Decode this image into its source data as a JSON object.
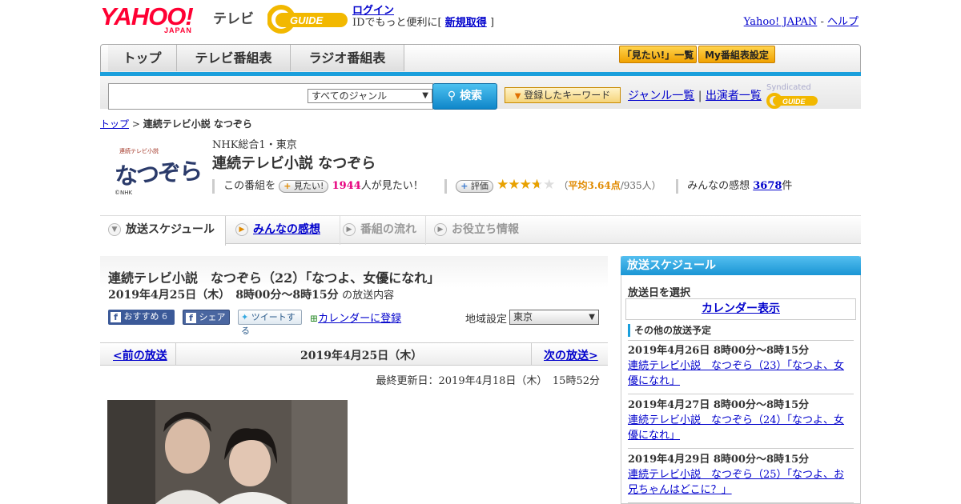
{
  "header": {
    "yahoo_logo": "YAHOO!",
    "yahoo_sub": "JAPAN",
    "tv_label": "テレビ",
    "gguide_logo": "G-GUIDE",
    "login_link": "ログイン",
    "login_text": "IDでもっと便利に[",
    "register_link": "新規取得",
    "login_close": "]",
    "yahoo_japan_link": "Yahoo! JAPAN",
    "separator": "-",
    "help_link": "ヘルプ"
  },
  "nav": {
    "tabs": [
      "トップ",
      "テレビ番組表",
      "ラジオ番組表"
    ],
    "want_list": "「見たい!」一覧",
    "my_schedule": "My番組表設定"
  },
  "search": {
    "input_value": "",
    "genre": "すべてのジャンル",
    "button": "検索",
    "keyword_button": "登録したキーワード",
    "genre_list": "ジャンル一覧",
    "divider": "|",
    "performer_list": "出演者一覧",
    "syndicated": "Syndicated"
  },
  "breadcrumb": {
    "top": "トップ",
    "sep": ">",
    "current": "連続テレビ小説 なつぞら"
  },
  "program": {
    "logo_text": "なつぞら",
    "logo_small": "連続テレビ小説",
    "logo_nhk": "©NHK",
    "channel": "NHK総合1・東京",
    "title": "連続テレビ小説 なつぞら",
    "want_prefix": "この番組を",
    "want_button": "見たい!",
    "want_count": "1944",
    "want_suffix": "人が見たい！",
    "rate_button": "評価",
    "rating": 3.64,
    "rating_open": "（",
    "rating_avg": "平均3.64点",
    "rating_count": "/935人）",
    "impressions_label": "みんなの感想",
    "impressions_count": "3678",
    "impressions_unit": "件"
  },
  "program_tabs": [
    "放送スケジュール",
    "みんなの感想",
    "番組の流れ",
    "お役立ち情報"
  ],
  "episode": {
    "title": "連続テレビ小説　なつぞら（22）「なつよ、女優になれ」",
    "datetime": "2019年4月25日（木）　8時00分～8時15分",
    "datetime_suffix": "の放送内容",
    "recommend_label": "おすすめ",
    "recommend_count": "6",
    "share_label": "シェア",
    "tweet_label": "ツイートする",
    "calendar_label": "カレンダーに登録",
    "region_label": "地域設定",
    "region_value": "東京",
    "prev": "<前の放送",
    "current_date": "2019年4月25日（木）",
    "next": "次の放送>",
    "updated": "最終更新日：2019年4月18日（木）　15時52分"
  },
  "sidebar": {
    "title": "放送スケジュール",
    "select_date": "放送日を選択",
    "calendar_link": "カレンダー表示",
    "other_label": "その他の放送予定",
    "items": [
      {
        "date": "2019年4月26日  8時00分～8時15分",
        "title": "連続テレビ小説　なつぞら（23）「なつよ、女優になれ」"
      },
      {
        "date": "2019年4月27日  8時00分～8時15分",
        "title": "連続テレビ小説　なつぞら（24）「なつよ、女優になれ」"
      },
      {
        "date": "2019年4月29日  8時00分～8時15分",
        "title": "連続テレビ小説　なつぞら（25）「なつよ、お兄ちゃんはどこに？」"
      }
    ]
  },
  "colors": {
    "accent_blue": "#1a9fdc",
    "yahoo_red": "#ff0033",
    "link": "#0000cc",
    "want_count": "#e6007e",
    "star": "#e8a100"
  }
}
